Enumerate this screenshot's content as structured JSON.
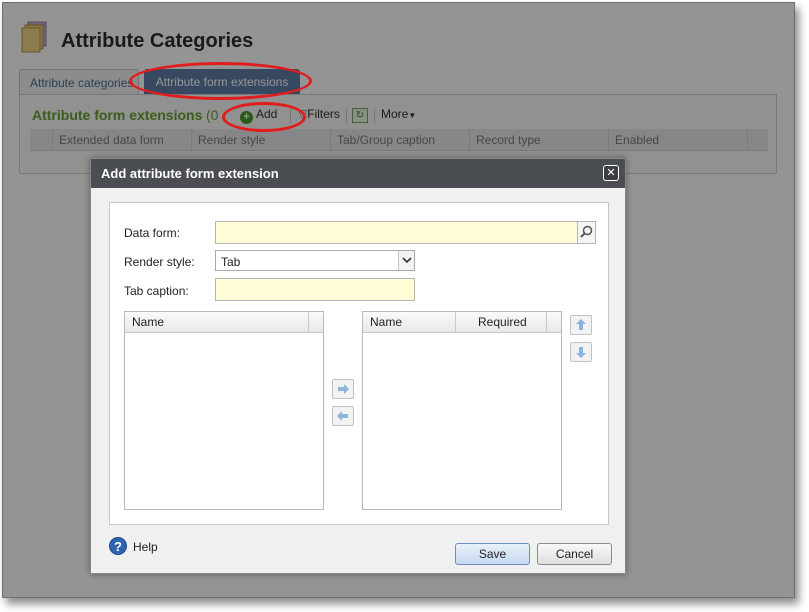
{
  "page": {
    "title": "Attribute Categories",
    "tabs": [
      {
        "label": "Attribute categories"
      },
      {
        "label": "Attribute form extensions"
      }
    ],
    "panel": {
      "title": "Attribute form extensions",
      "count_prefix": "(0",
      "toolbar": {
        "add_label": "Add",
        "filters_label": "Filters",
        "more_label": "More"
      },
      "columns": [
        "Extended data form",
        "Render style",
        "Tab/Group caption",
        "Record type",
        "Enabled"
      ]
    }
  },
  "dialog": {
    "title": "Add attribute form extension",
    "fields": {
      "data_form_label": "Data form:",
      "data_form_value": "",
      "render_style_label": "Render style:",
      "render_style_value": "Tab",
      "tab_caption_label": "Tab caption:",
      "tab_caption_value": ""
    },
    "available_list": {
      "columns": [
        "Name"
      ]
    },
    "selected_list": {
      "columns": [
        "Name",
        "Required"
      ]
    },
    "help_label": "Help",
    "save_label": "Save",
    "cancel_label": "Cancel"
  },
  "colors": {
    "dialog_titlebar": "#4a4d52",
    "active_tab": "#5d7fa7",
    "panel_title": "#6aa02e",
    "annotation_red": "#e21c1c",
    "input_yellow": "#fffcd6"
  }
}
